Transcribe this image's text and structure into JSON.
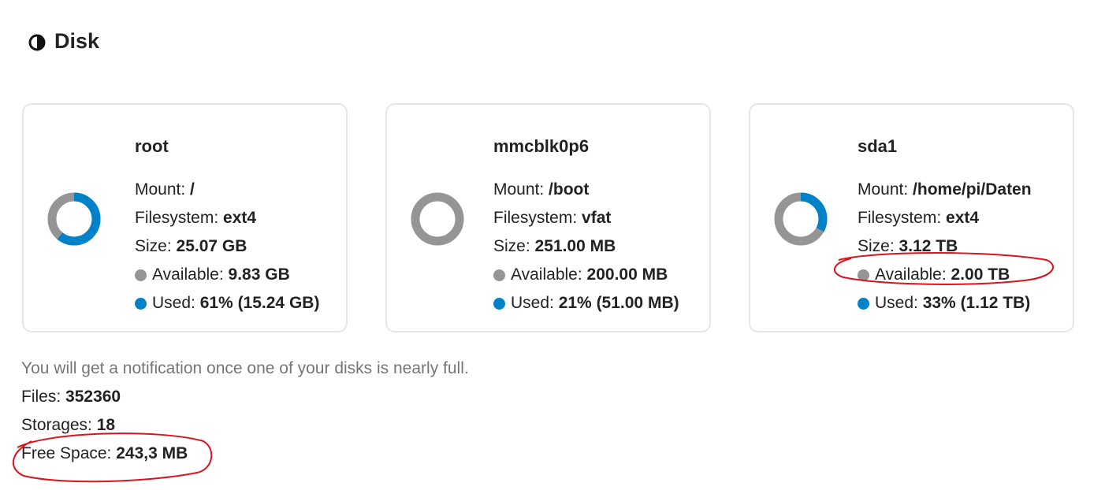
{
  "section": {
    "title": "Disk",
    "icon": "half-circle-icon"
  },
  "colors": {
    "used": "#0082c9",
    "available": "#959595",
    "annotation": "#d9141e"
  },
  "disks": [
    {
      "name": "root",
      "mount_label": "Mount:",
      "mount": "/",
      "filesystem_label": "Filesystem:",
      "filesystem": "ext4",
      "size_label": "Size:",
      "size": "25.07 GB",
      "available_label": "Available:",
      "available": "9.83 GB",
      "used_label": "Used:",
      "used": "61% (15.24 GB)",
      "used_fraction": 0.61
    },
    {
      "name": "mmcblk0p6",
      "mount_label": "Mount:",
      "mount": "/boot",
      "filesystem_label": "Filesystem:",
      "filesystem": "vfat",
      "size_label": "Size:",
      "size": "251.00 MB",
      "available_label": "Available:",
      "available": "200.00 MB",
      "used_label": "Used:",
      "used": "21% (51.00 MB)",
      "used_fraction": 0.0
    },
    {
      "name": "sda1",
      "mount_label": "Mount:",
      "mount": "/home/pi/Daten",
      "filesystem_label": "Filesystem:",
      "filesystem": "ext4",
      "size_label": "Size:",
      "size": "3.12 TB",
      "available_label": "Available:",
      "available": "2.00 TB",
      "used_label": "Used:",
      "used": "33% (1.12 TB)",
      "used_fraction": 0.33
    }
  ],
  "summary": {
    "notice": "You will get a notification once one of your disks is nearly full.",
    "files_label": "Files:",
    "files": "352360",
    "storages_label": "Storages:",
    "storages": "18",
    "free_space_label": "Free Space:",
    "free_space": "243,3 MB"
  }
}
